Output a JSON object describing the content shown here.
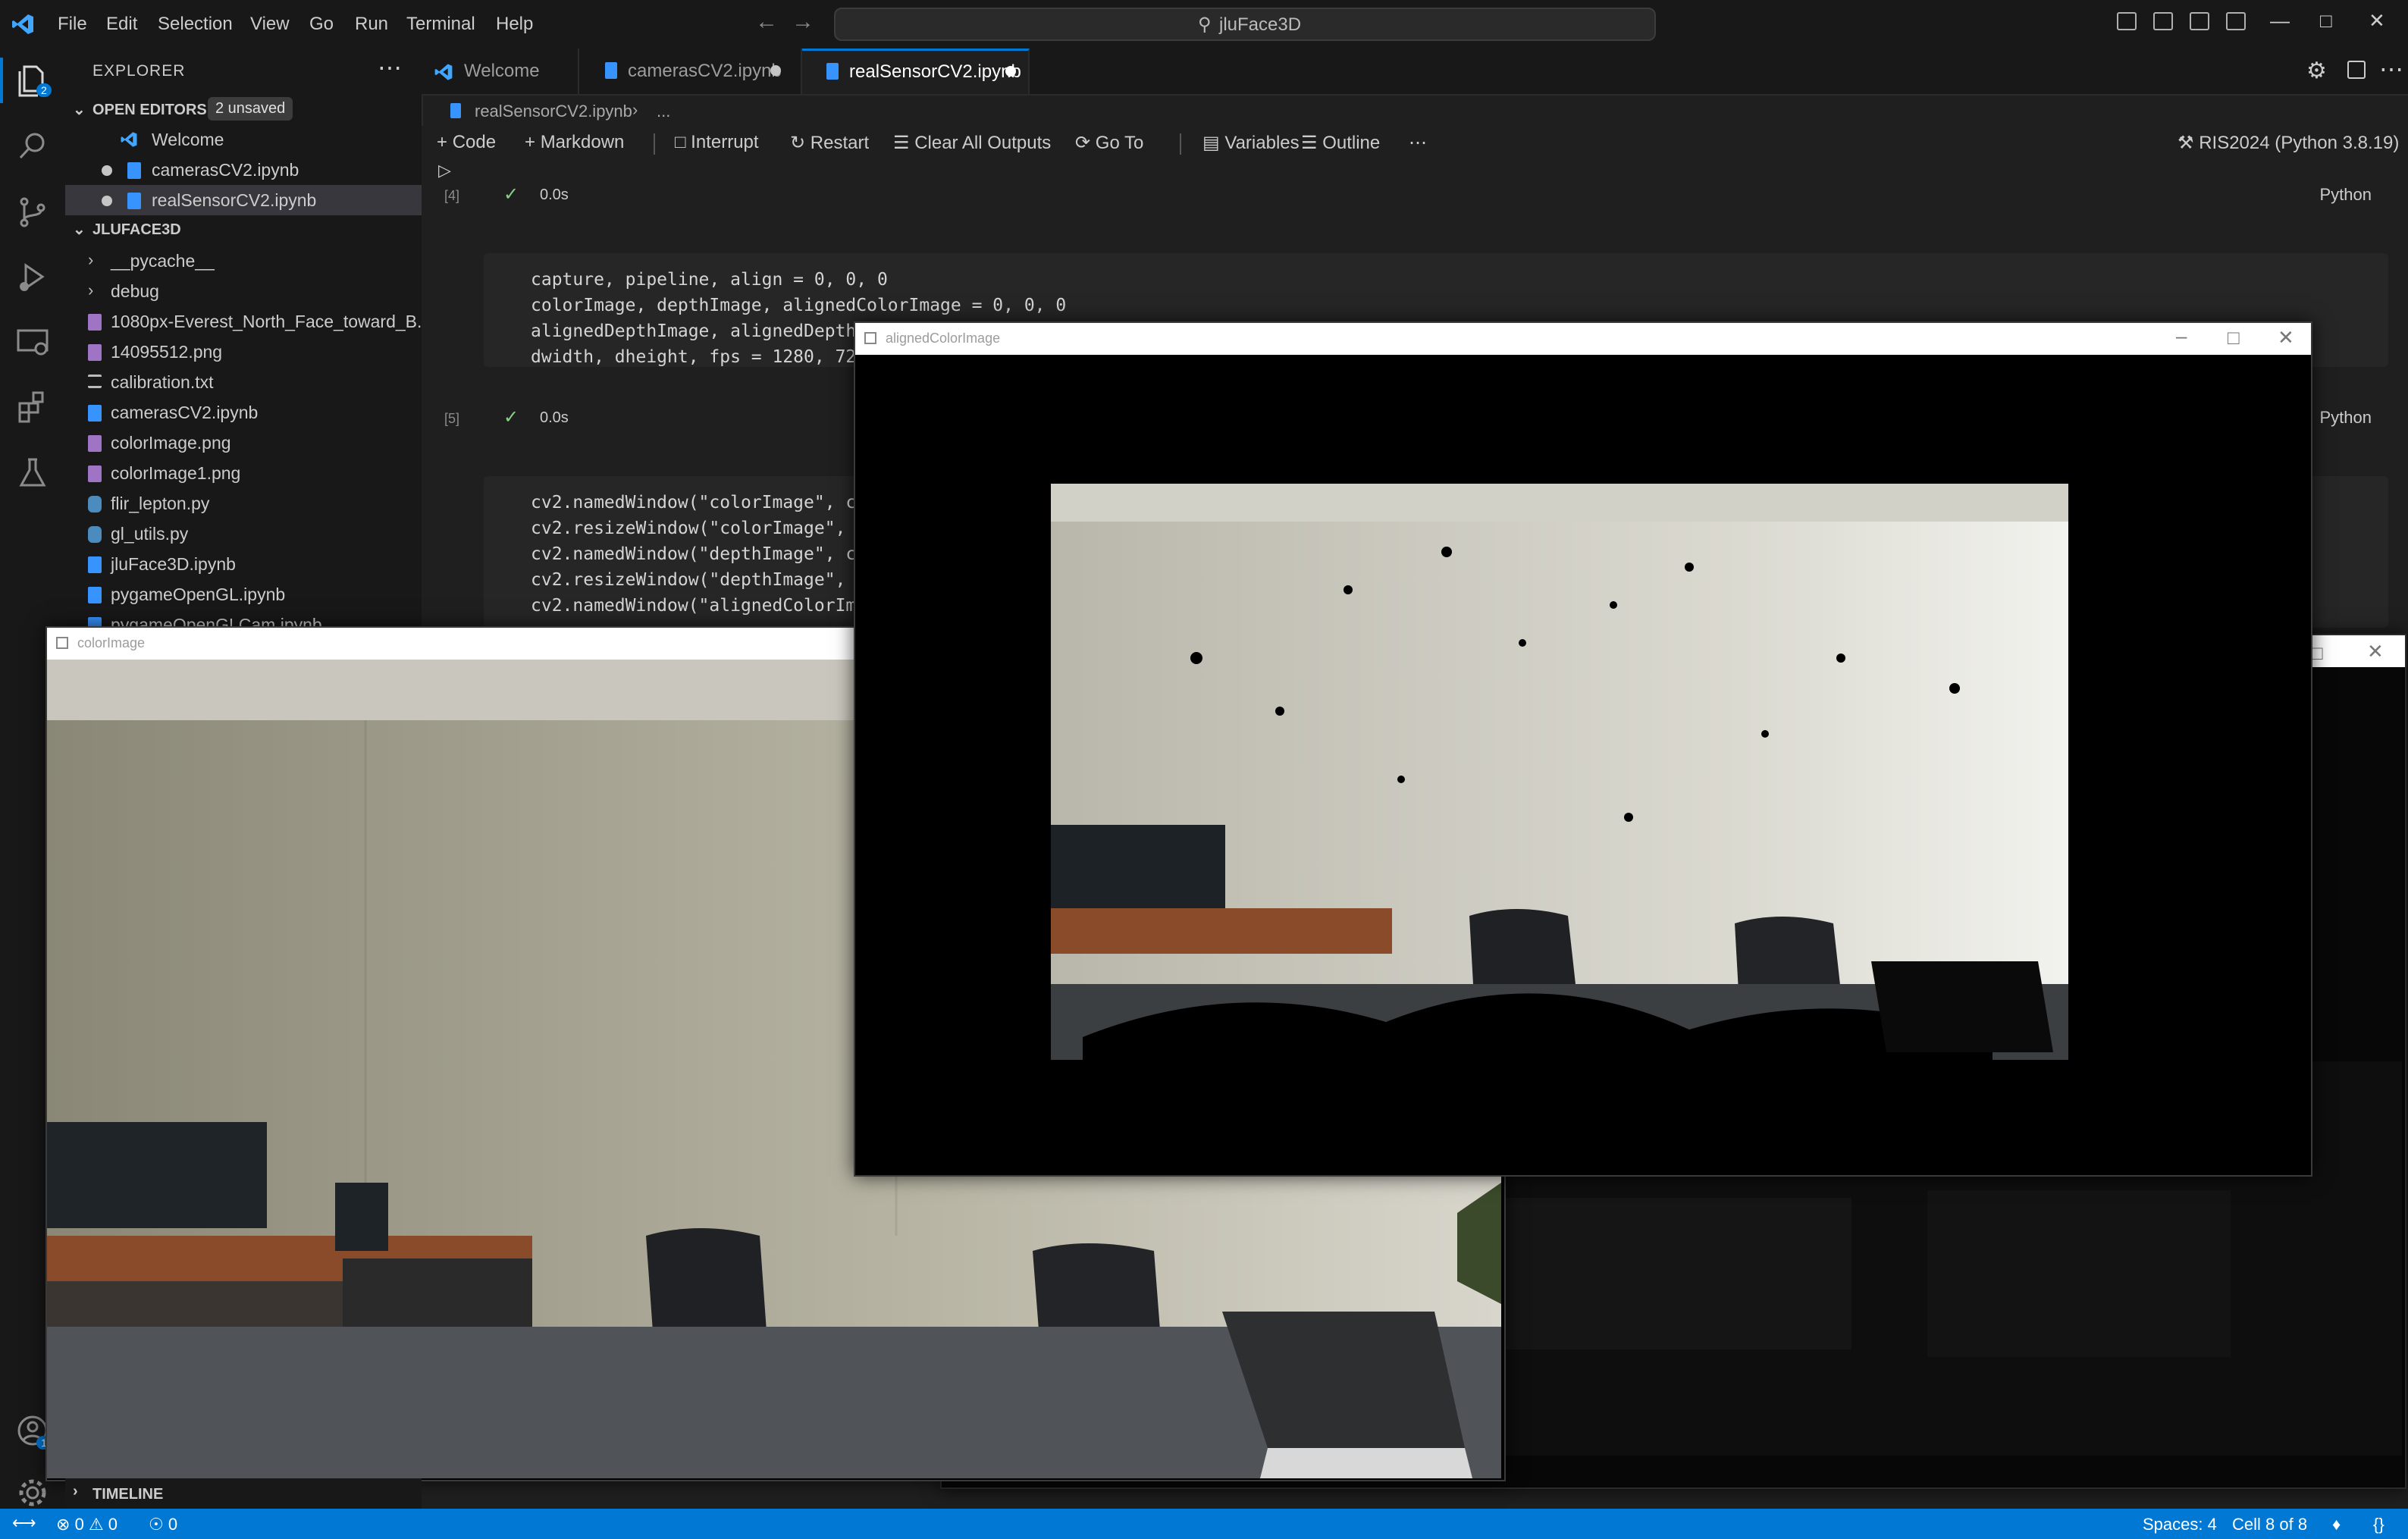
{
  "app": {
    "title": "jluFace3D"
  },
  "menu": [
    "File",
    "Edit",
    "Selection",
    "View",
    "Go",
    "Run",
    "Terminal",
    "Help"
  ],
  "activity": {
    "explorer_badge": "2",
    "accounts_badge": "1"
  },
  "sidebar": {
    "title": "EXPLORER",
    "open_editors": {
      "label": "OPEN EDITORS",
      "badge": "2 unsaved",
      "items": [
        "Welcome",
        "camerasCV2.ipynb",
        "realSensorCV2.ipynb"
      ]
    },
    "folder": {
      "label": "JLUFACE3D",
      "items": [
        "__pycache__",
        "debug",
        "1080px-Everest_North_Face_toward_B...",
        "14095512.png",
        "calibration.txt",
        "camerasCV2.ipynb",
        "colorImage.png",
        "colorImage1.png",
        "flir_lepton.py",
        "gl_utils.py",
        "jluFace3D.ipynb",
        "pygameOpenGL.ipynb",
        "pygameOpenGLCam.ipynb"
      ]
    },
    "timeline": "TIMELINE"
  },
  "tabs": [
    {
      "label": "Welcome",
      "icon": "vscode-icon"
    },
    {
      "label": "camerasCV2.ipynb",
      "icon": "notebook-icon"
    },
    {
      "label": "realSensorCV2.ipynb",
      "icon": "notebook-icon"
    }
  ],
  "breadcrumb": {
    "file": "realSensorCV2.ipynb",
    "rest": "..."
  },
  "toolbar": {
    "code": "Code",
    "markdown": "Markdown",
    "interrupt": "Interrupt",
    "restart": "Restart",
    "clear": "Clear All Outputs",
    "goto": "Go To",
    "variables": "Variables",
    "outline": "Outline",
    "more": "⋯",
    "kernel": "RIS2024 (Python 3.8.19)"
  },
  "cells": [
    {
      "exec": "[4]",
      "time": "0.0s",
      "lang": "Python"
    },
    {
      "exec": "[5]",
      "time": "0.0s",
      "lang": "Python",
      "lines": [
        "capture, pipeline, align = 0, 0, 0",
        "colorImage, depthImage, alignedColorImage = 0, 0, 0",
        "alignedDepthImage, alignedDepth",
        "dwidth, dheight, fps = 1280, 72"
      ]
    },
    {
      "lines": [
        "cv2.namedWindow(\"colorImage\", c",
        "cv2.resizeWindow(\"colorImage\",",
        "cv2.namedWindow(\"depthImage\", c",
        "cv2.resizeWindow(\"depthImage\",",
        "cv2.namedWindow(\"alignedColorIm"
      ]
    }
  ],
  "windows": {
    "colorImage": "colorImage",
    "alignedColorImage": "alignedColorImage"
  },
  "status": {
    "errors": "0",
    "warnings": "0",
    "ports": "0",
    "spaces": "Spaces: 4",
    "cell": "Cell 8 of 8"
  },
  "colors": {
    "accent": "#0078d4",
    "statusbar": "#0078d4",
    "editor_bg": "#1f1f1f",
    "sidebar_bg": "#181818"
  }
}
